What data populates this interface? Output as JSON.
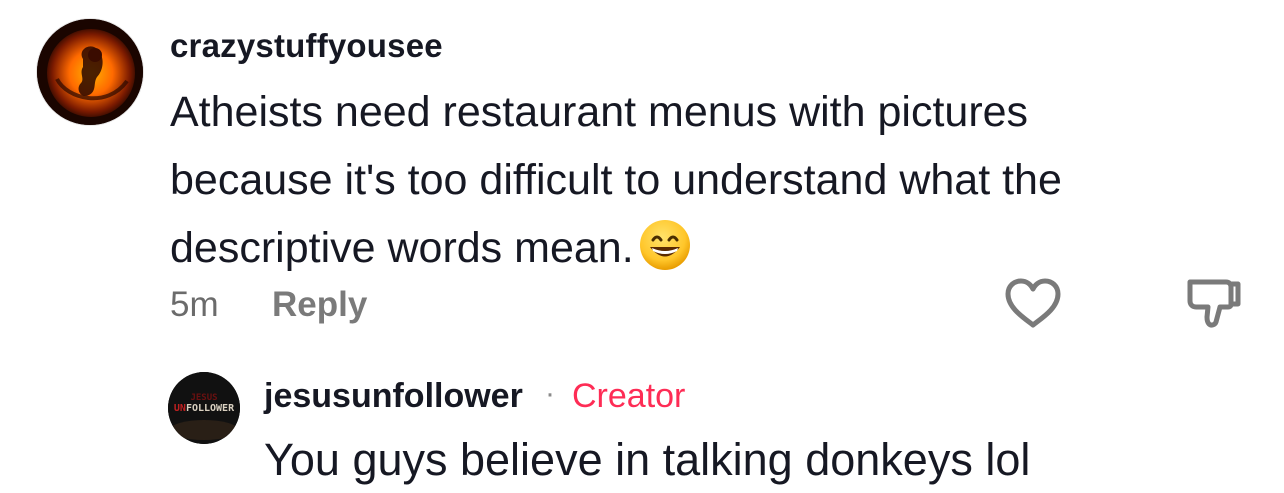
{
  "comment": {
    "username": "crazystuffyousee",
    "text": "Atheists need restaurant menus with pictures because it's too difficult to understand what the descriptive words mean.",
    "emoji": "grinning-face-with-smiling-eyes",
    "timestamp": "5m",
    "reply_label": "Reply",
    "like_icon": "heart-outline-icon",
    "dislike_icon": "thumbs-down-outline-icon"
  },
  "reply": {
    "username": "jesusunfollower",
    "separator": "·",
    "badge": "Creator",
    "text": "You guys believe in talking donkeys lol",
    "avatar_text_top": "JESUS",
    "avatar_text_main": "UNFOLLOWER"
  },
  "colors": {
    "text": "#161823",
    "muted": "#7a7a7a",
    "creator": "#fe2c55"
  }
}
